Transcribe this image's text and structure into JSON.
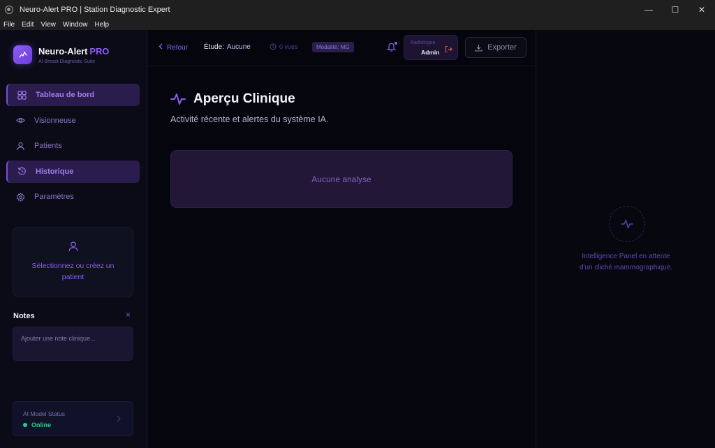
{
  "window": {
    "title": "Neuro-Alert PRO | Station Diagnostic Expert",
    "controls": [
      "—",
      "☐",
      "✕"
    ]
  },
  "menu": [
    "File",
    "Edit",
    "View",
    "Window",
    "Help"
  ],
  "brand": {
    "name": "Neuro-Alert",
    "pro": "PRO",
    "subtitle": "AI Breast Diagnostic Suite"
  },
  "nav": [
    {
      "label": "Tableau de bord",
      "icon": "grid-icon",
      "active": true
    },
    {
      "label": "Visionneuse",
      "icon": "eye-icon",
      "active": false
    },
    {
      "label": "Patients",
      "icon": "user-icon",
      "active": false
    },
    {
      "label": "Historique",
      "icon": "history-icon",
      "active": true
    },
    {
      "label": "Paramètres",
      "icon": "gear-icon",
      "active": false
    }
  ],
  "patient_card": {
    "text": "Sélectionnez ou créez un patient"
  },
  "notes": {
    "title": "Notes",
    "close": "×",
    "placeholder": "Ajouter une note clinique..."
  },
  "ai_status": {
    "label": "AI Model Status",
    "value": "Online"
  },
  "topbar": {
    "back": "Retour",
    "study_label": "Étude:",
    "study_value": "Aucune",
    "views": "0 vues",
    "modality": "Modalité: MG",
    "user_role": "Radiologue",
    "user_name": "Admin",
    "export": "Exporter"
  },
  "main": {
    "title": "Aperçu Clinique",
    "subtitle": "Activité récente et alertes du système IA.",
    "empty_card": "Aucune analyse"
  },
  "right_panel": {
    "text_line1": "Intelligence Panel en attente",
    "text_line2": "d'un cliché mammographique."
  },
  "colors": {
    "accent": "#8b5cf6",
    "online": "#22d07f",
    "background": "#05060d"
  }
}
